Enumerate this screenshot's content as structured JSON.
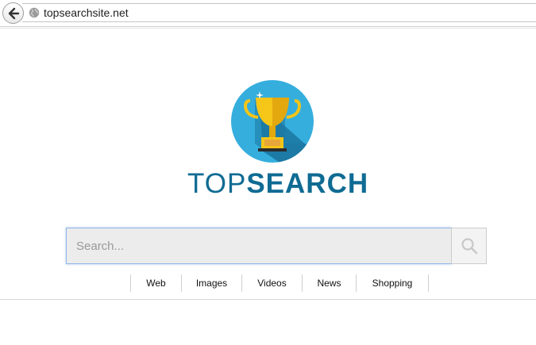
{
  "browser": {
    "url": "topsearchsite.net"
  },
  "brand": {
    "part1": "TOP",
    "part2": "SEARCH"
  },
  "search": {
    "placeholder": "Search...",
    "value": ""
  },
  "nav": {
    "items": [
      {
        "label": "Web"
      },
      {
        "label": "Images"
      },
      {
        "label": "Videos"
      },
      {
        "label": "News"
      },
      {
        "label": "Shopping"
      }
    ]
  },
  "colors": {
    "brand_blue": "#0f6b93",
    "logo_circle": "#35aedd",
    "trophy_gold": "#f5c518"
  },
  "icons": {
    "back": "back-arrow-icon",
    "site": "globe-icon",
    "search": "search-icon",
    "logo": "trophy-icon"
  }
}
